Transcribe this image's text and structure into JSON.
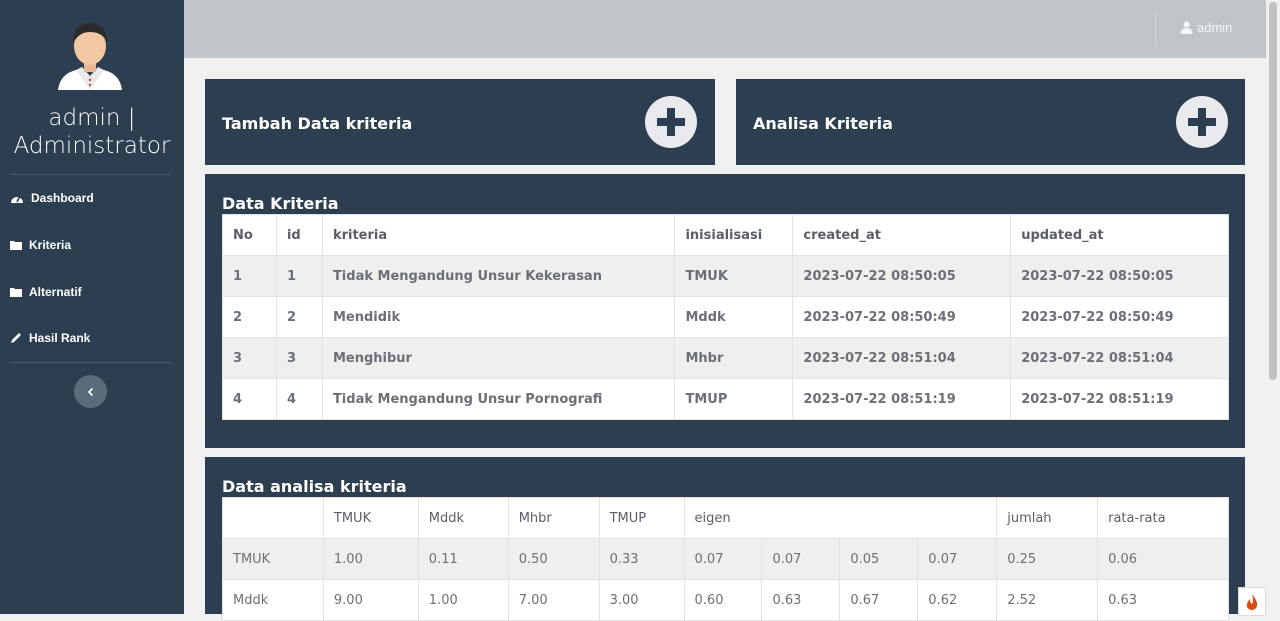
{
  "sidebar": {
    "user_line1": "admin |",
    "user_line2": "Administrator",
    "items": [
      {
        "label": "Dashboard",
        "icon": "gauge-icon"
      },
      {
        "label": "Kriteria",
        "icon": "folder-icon"
      },
      {
        "label": "Alternatif",
        "icon": "folder-icon"
      },
      {
        "label": "Hasil Rank",
        "icon": "pen-icon"
      }
    ]
  },
  "topbar": {
    "user_label": "admin"
  },
  "actions": {
    "add_kriteria": "Tambah Data kriteria",
    "analisa": "Analisa Kriteria"
  },
  "kriteria": {
    "title": "Data Kriteria",
    "headers": [
      "No",
      "id",
      "kriteria",
      "inisialisasi",
      "created_at",
      "updated_at"
    ],
    "rows": [
      [
        "1",
        "1",
        "Tidak Mengandung Unsur Kekerasan",
        "TMUK",
        "2023-07-22 08:50:05",
        "2023-07-22 08:50:05"
      ],
      [
        "2",
        "2",
        "Mendidik",
        "Mddk",
        "2023-07-22 08:50:49",
        "2023-07-22 08:50:49"
      ],
      [
        "3",
        "3",
        "Menghibur",
        "Mhbr",
        "2023-07-22 08:51:04",
        "2023-07-22 08:51:04"
      ],
      [
        "4",
        "4",
        "Tidak Mengandung Unsur Pornografi",
        "TMUP",
        "2023-07-22 08:51:19",
        "2023-07-22 08:51:19"
      ]
    ]
  },
  "analisa": {
    "title": "Data analisa kriteria",
    "headers": [
      "",
      "TMUK",
      "Mddk",
      "Mhbr",
      "TMUP",
      "eigen",
      "jumlah",
      "rata-rata"
    ],
    "rows": [
      [
        "TMUK",
        "1.00",
        "0.11",
        "0.50",
        "0.33",
        "0.07",
        "0.07",
        "0.05",
        "0.07",
        "0.25",
        "0.06"
      ],
      [
        "Mddk",
        "9.00",
        "1.00",
        "7.00",
        "3.00",
        "0.60",
        "0.63",
        "0.67",
        "0.62",
        "2.52",
        "0.63"
      ]
    ]
  },
  "colors": {
    "sidebar": "#2c3e50",
    "card": "#2c3e50",
    "topbar": "#bfc4c8",
    "page": "#f0f0f0"
  }
}
